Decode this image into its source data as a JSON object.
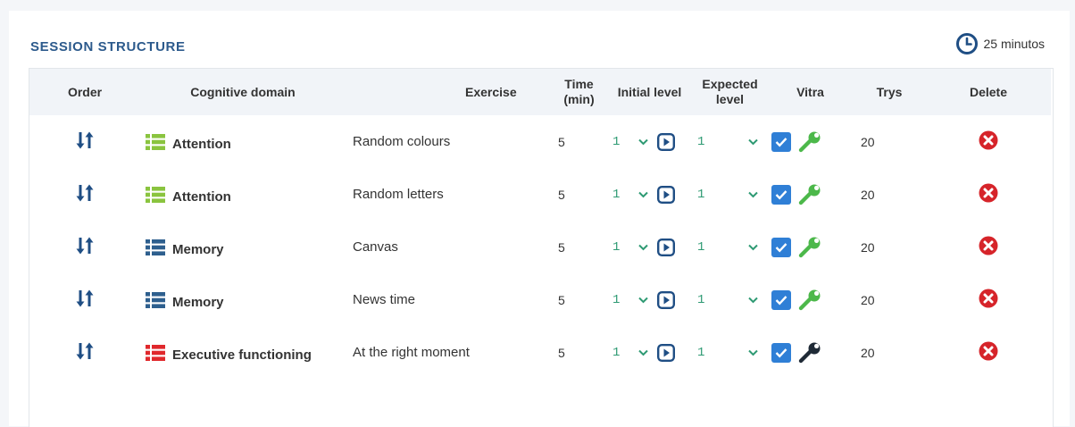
{
  "section": {
    "title": "SESSION STRUCTURE",
    "duration": "25 minutos",
    "duration_icon": "clock-icon"
  },
  "columns": {
    "order": "Order",
    "domain": "Cognitive domain",
    "exercise": "Exercise",
    "time_l1": "Time",
    "time_l2": "(min)",
    "initial": "Initial level",
    "expected_l1": "Expected",
    "expected_l2": "level",
    "vitra": "Vitra",
    "trys": "Trys",
    "delete": "Delete"
  },
  "colors": {
    "attention": "#8ac43f",
    "memory": "#2e5f8e",
    "executive": "#e0282c",
    "checkbox": "#2f7fd6",
    "wrench_green": "#4cb84a",
    "wrench_dark": "#1f2a36",
    "delete": "#d6242a",
    "accent": "#2c5a8c"
  },
  "rows": [
    {
      "domain": "Attention",
      "exercise": "Random colours",
      "time": "5",
      "initial": "1",
      "expected": "1",
      "vitra_checked": true,
      "wrench": "green",
      "trys": "20"
    },
    {
      "domain": "Attention",
      "exercise": "Random letters",
      "time": "5",
      "initial": "1",
      "expected": "1",
      "vitra_checked": true,
      "wrench": "green",
      "trys": "20"
    },
    {
      "domain": "Memory",
      "exercise": "Canvas",
      "time": "5",
      "initial": "1",
      "expected": "1",
      "vitra_checked": true,
      "wrench": "green",
      "trys": "20"
    },
    {
      "domain": "Memory",
      "exercise": "News time",
      "time": "5",
      "initial": "1",
      "expected": "1",
      "vitra_checked": true,
      "wrench": "green",
      "trys": "20"
    },
    {
      "domain": "Executive functioning",
      "exercise": "At the right moment",
      "time": "5",
      "initial": "1",
      "expected": "1",
      "vitra_checked": true,
      "wrench": "dark",
      "trys": "20"
    }
  ]
}
